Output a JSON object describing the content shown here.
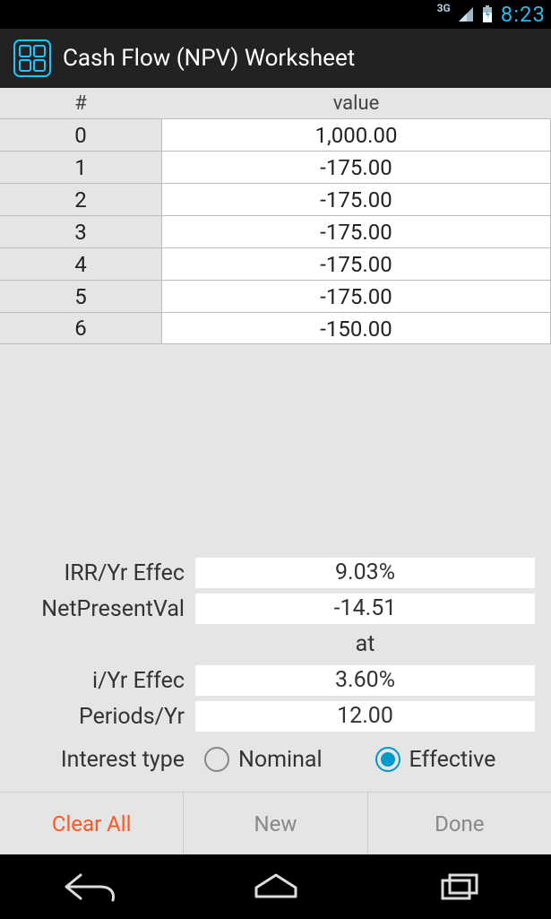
{
  "status": {
    "network": "3G",
    "time": "8:23"
  },
  "appbar": {
    "title": "Cash Flow (NPV) Worksheet"
  },
  "table": {
    "header_idx": "#",
    "header_val": "value",
    "rows": [
      {
        "idx": "0",
        "val": "1,000.00"
      },
      {
        "idx": "1",
        "val": "-175.00"
      },
      {
        "idx": "2",
        "val": "-175.00"
      },
      {
        "idx": "3",
        "val": "-175.00"
      },
      {
        "idx": "4",
        "val": "-175.00"
      },
      {
        "idx": "5",
        "val": "-175.00"
      },
      {
        "idx": "6",
        "val": "-150.00"
      }
    ]
  },
  "results": {
    "irr_label": "IRR/Yr Effec",
    "irr_value": "9.03%",
    "npv_label": "NetPresentVal",
    "npv_value": "-14.51",
    "at_label": "at",
    "rate_label": "i/Yr Effec",
    "rate_value": "3.60%",
    "periods_label": "Periods/Yr",
    "periods_value": "12.00",
    "interest_type_label": "Interest type",
    "radio_nominal": "Nominal",
    "radio_effective": "Effective",
    "selected_interest_type": "effective"
  },
  "actions": {
    "clear": "Clear All",
    "new": "New",
    "done": "Done"
  }
}
